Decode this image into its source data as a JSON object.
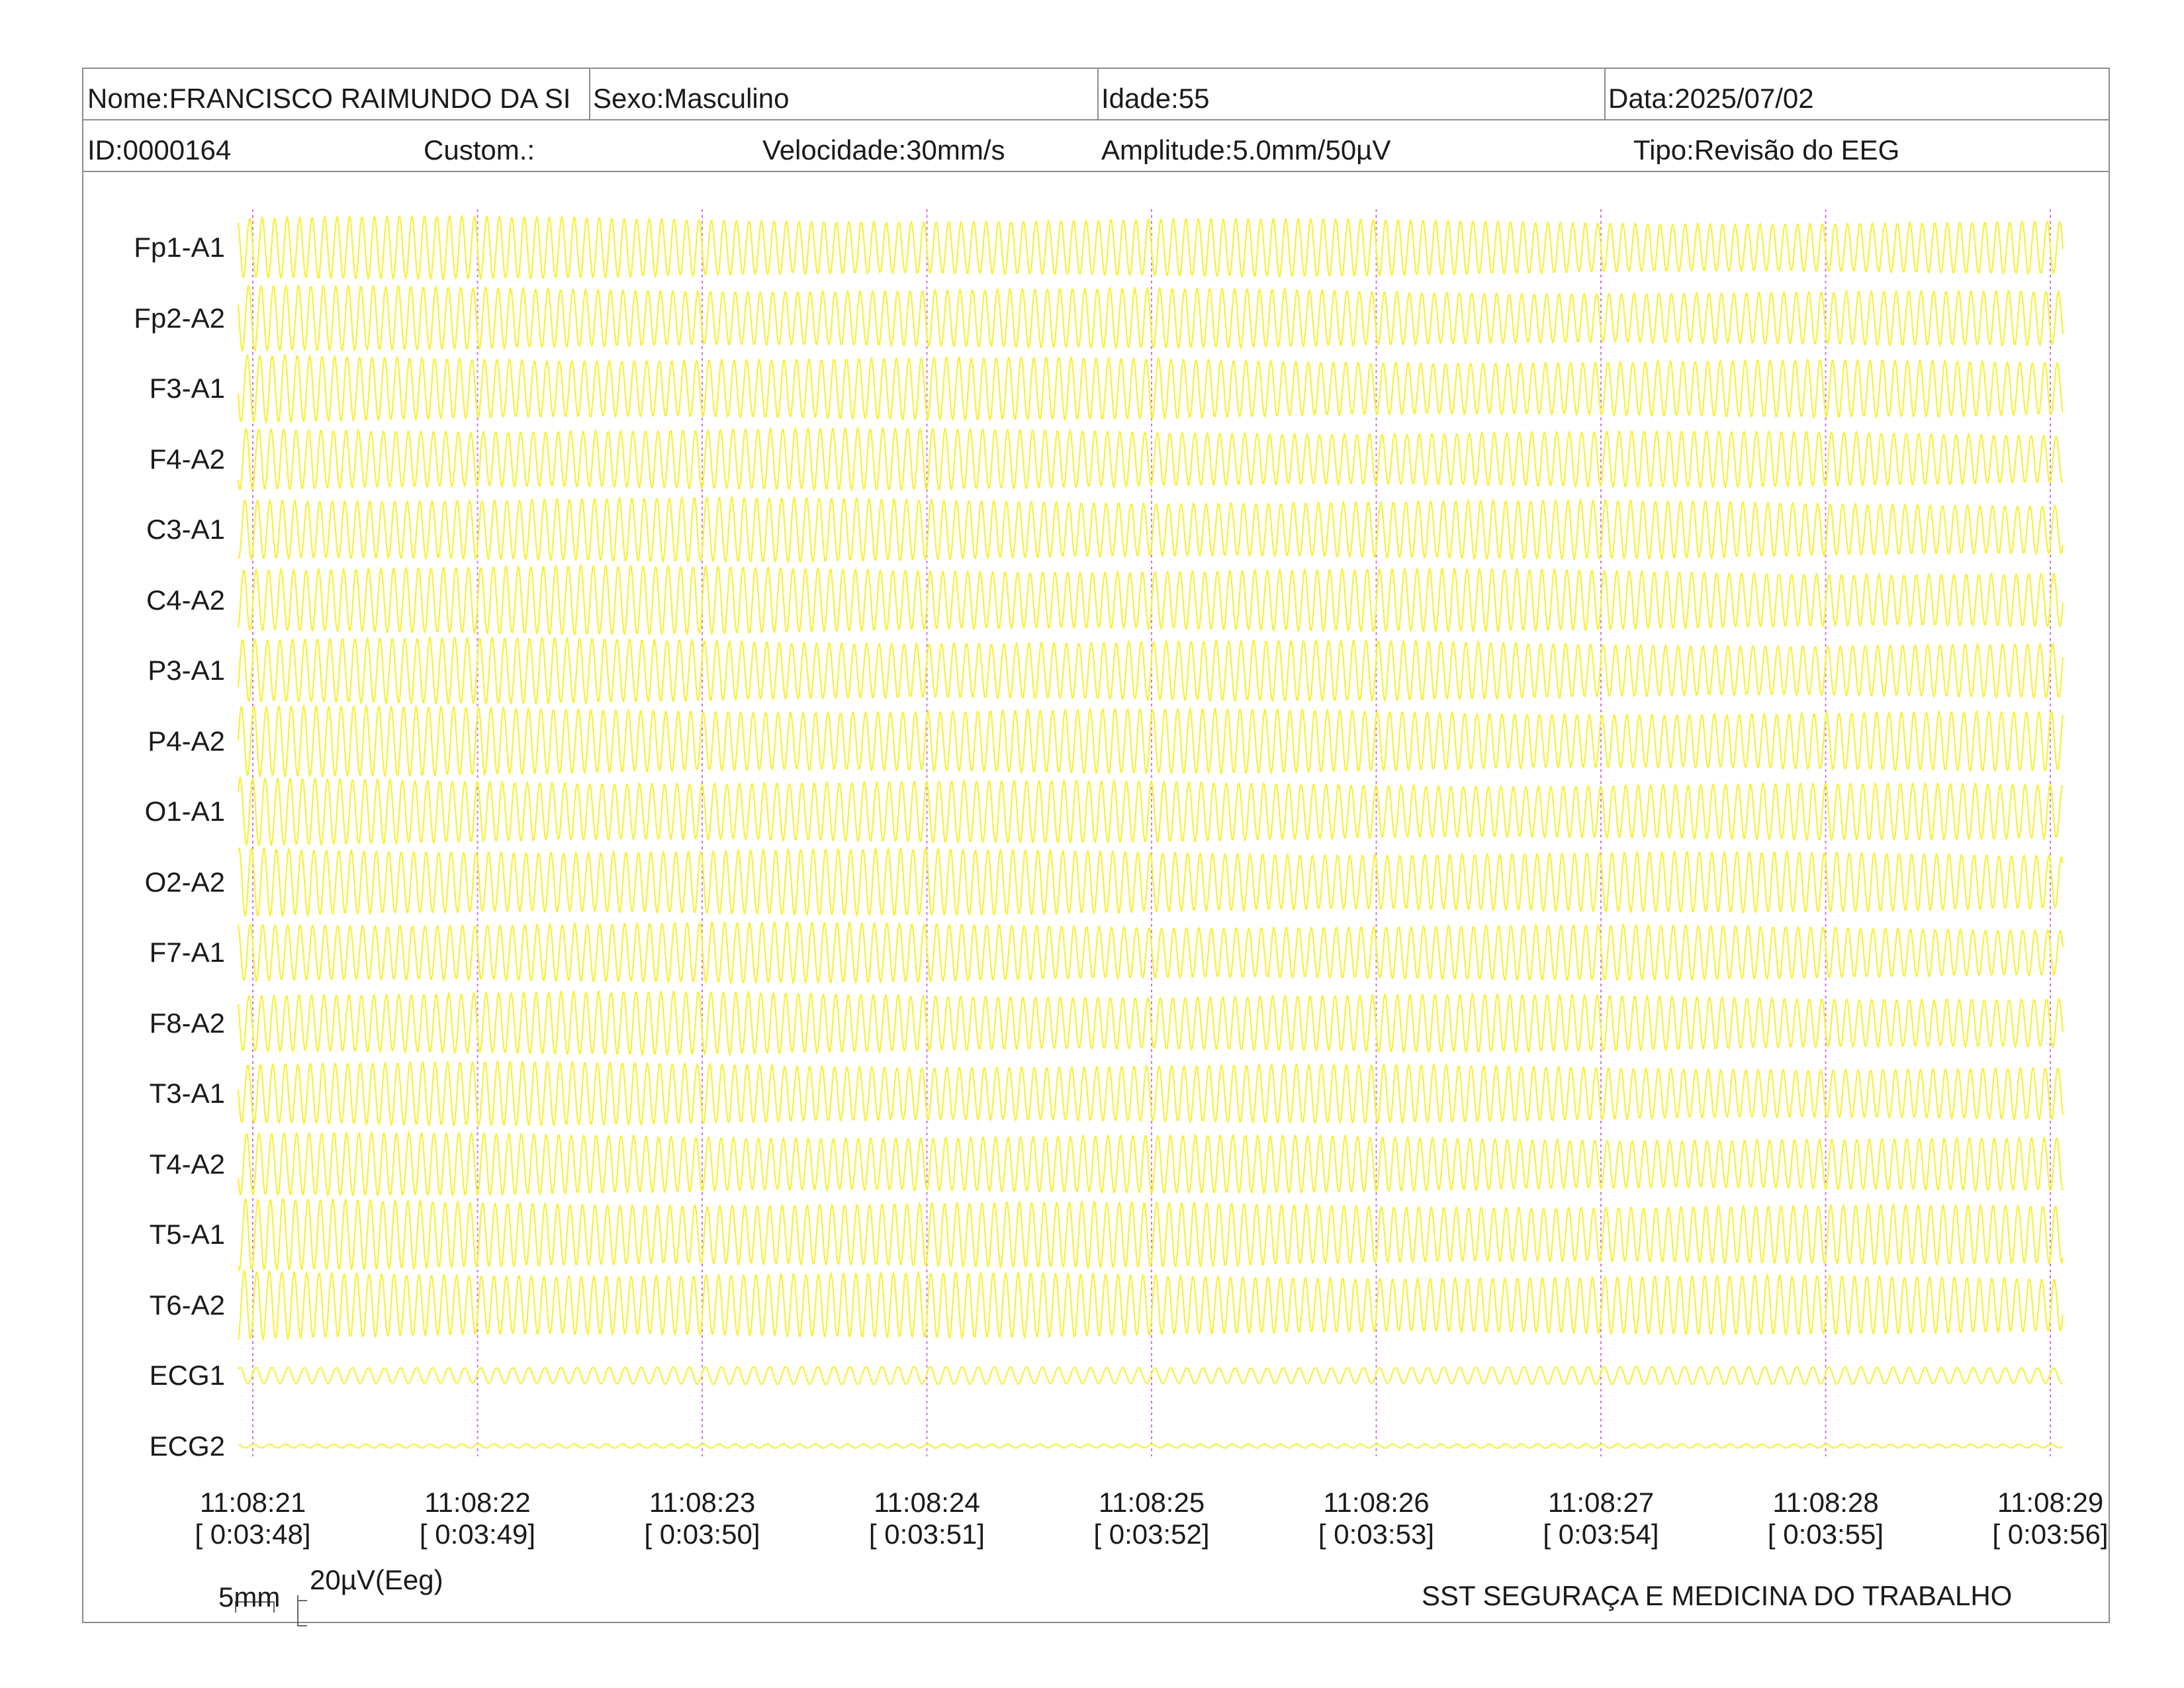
{
  "header": {
    "nome": "Nome:FRANCISCO RAIMUNDO DA SI",
    "sexo": "Sexo:Masculino",
    "idade": "Idade:55",
    "data": "Data:2025/07/02",
    "id": "ID:0000164",
    "custom": "Custom.:",
    "velocidade": "Velocidade:30mm/s",
    "amplitude": "Amplitude:5.0mm/50µV",
    "tipo": "Tipo:Revisão do EEG"
  },
  "calibration": {
    "time_scale": "5mm",
    "amp_scale": "20µV(Eeg)"
  },
  "footer": {
    "company": "SST SEGURAÇA E MEDICINA DO TRABALHO"
  },
  "colors": {
    "trace": "#f5f13a",
    "marker": "#d070e0",
    "border": "#8c8c8c",
    "text": "#1a1a1a"
  },
  "chart_data": {
    "type": "line",
    "channels": [
      "Fp1-A1",
      "Fp2-A2",
      "F3-A1",
      "F4-A2",
      "C3-A1",
      "C4-A2",
      "P3-A1",
      "P4-A2",
      "O1-A1",
      "O2-A2",
      "F7-A1",
      "F8-A2",
      "T3-A1",
      "T4-A2",
      "T5-A1",
      "T6-A2",
      "ECG1",
      "ECG2"
    ],
    "clock_times": [
      "11:08:21",
      "11:08:22",
      "11:08:23",
      "11:08:24",
      "11:08:25",
      "11:08:26",
      "11:08:27",
      "11:08:28",
      "11:08:29"
    ],
    "record_times": [
      "[ 0:03:48]",
      "[ 0:03:49]",
      "[ 0:03:50]",
      "[ 0:03:51]",
      "[ 0:03:52]",
      "[ 0:03:53]",
      "[ 0:03:54]",
      "[ 0:03:55]",
      "[ 0:03:56]"
    ],
    "x_range_seconds": [
      0,
      8
    ],
    "oscillation_hz": 18,
    "amplitude_relative": [
      0.9,
      0.92,
      0.95,
      0.92,
      0.95,
      1.0,
      0.95,
      1.0,
      0.95,
      1.0,
      0.9,
      0.92,
      0.92,
      0.9,
      1.0,
      0.98,
      0.25,
      0.06
    ],
    "grid": true,
    "legend": "none"
  }
}
